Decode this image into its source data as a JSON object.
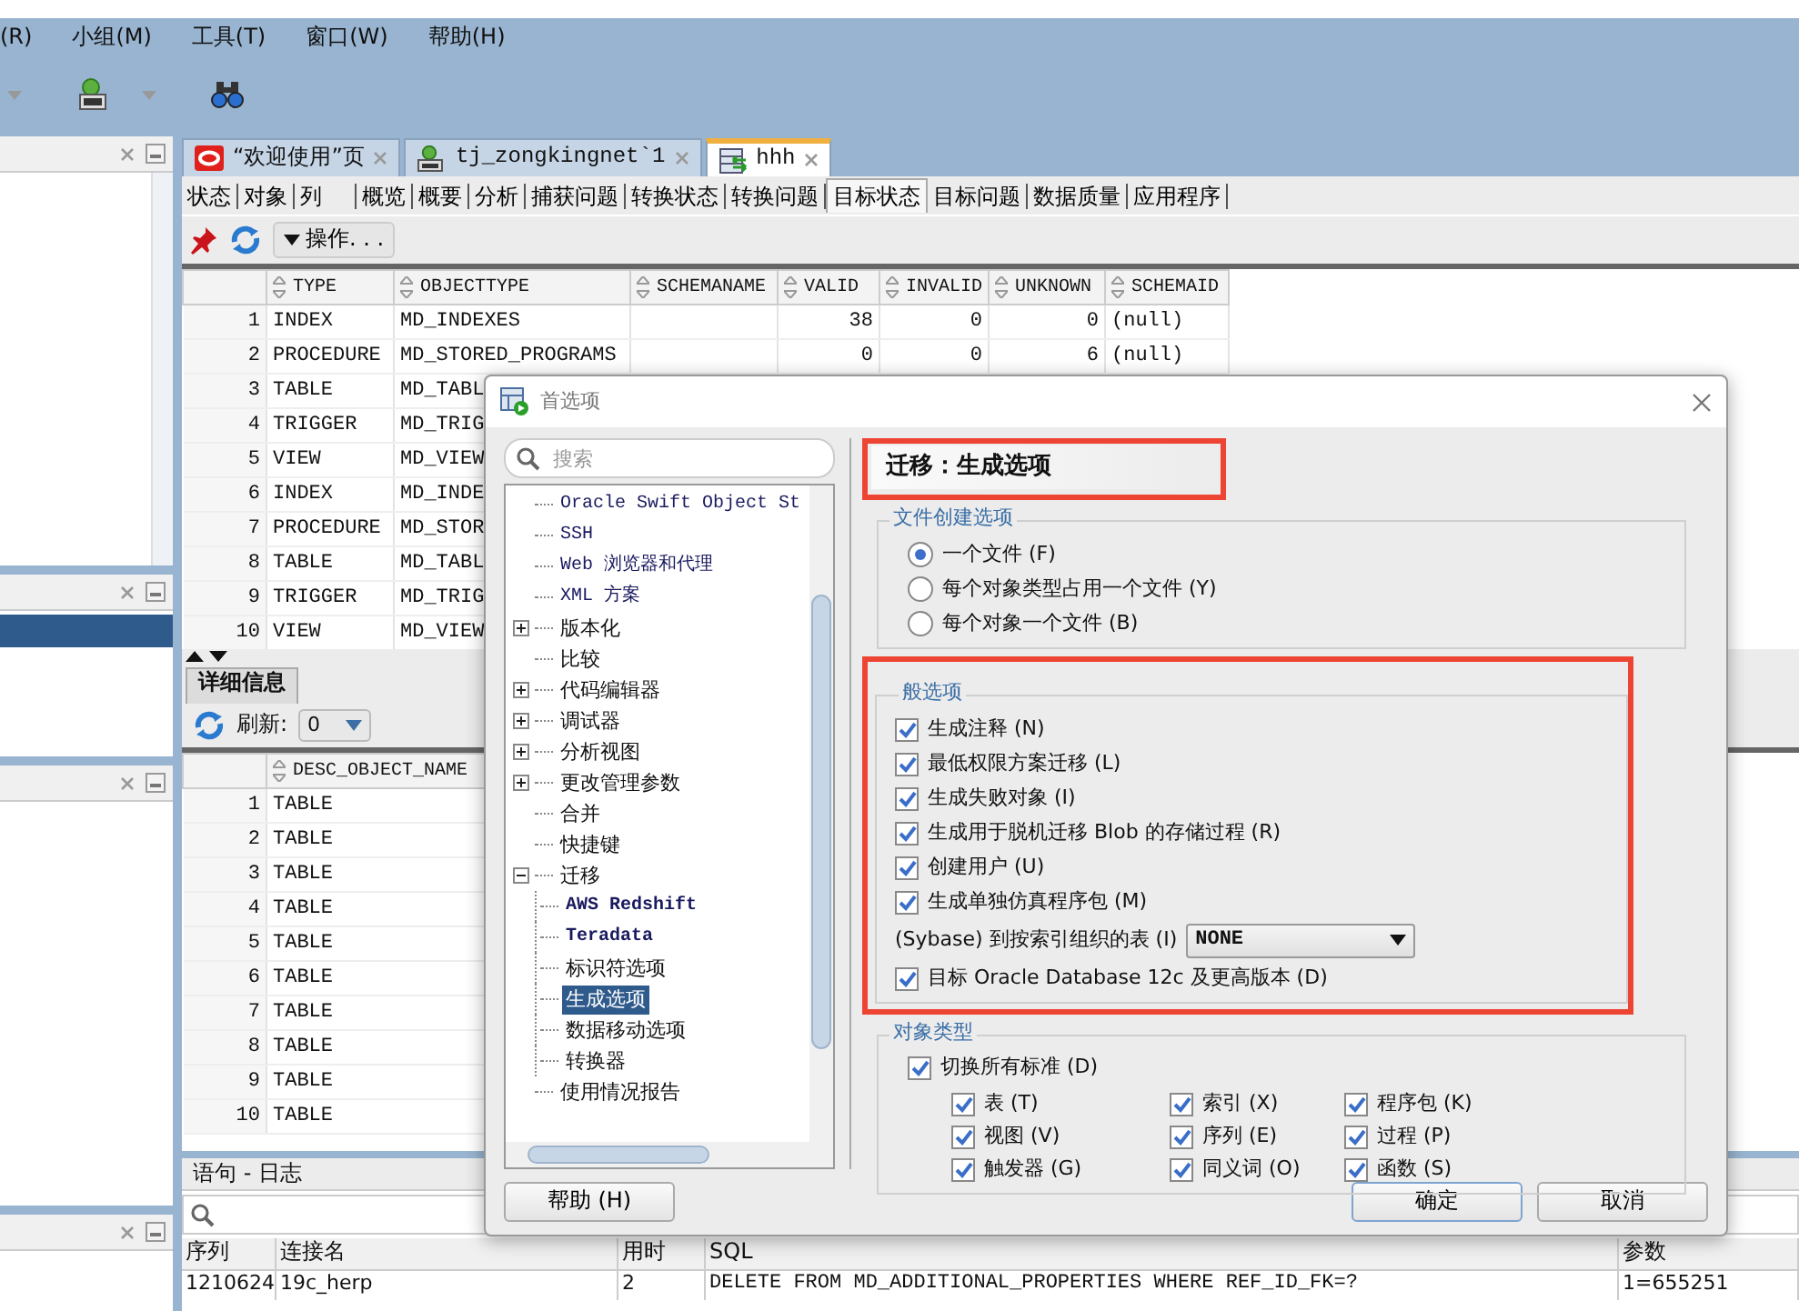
{
  "menu": [
    "(R)",
    "小组(M)",
    "工具(T)",
    "窗口(W)",
    "帮助(H)"
  ],
  "left_panels": [
    {
      "kind": "empty"
    },
    {
      "kind": "list",
      "rows": [
        {
          "selected": true
        }
      ]
    },
    {
      "kind": "empty"
    },
    {
      "kind": "empty"
    }
  ],
  "editor": {
    "tabs": [
      {
        "label": "“欢迎使用”页",
        "kind": "oracle",
        "selected": false
      },
      {
        "label": "tj_zongkingnet`1",
        "kind": "sql",
        "selected": false
      },
      {
        "label": "hhh",
        "kind": "database",
        "selected": true
      }
    ],
    "subtabs": [
      {
        "label": "状态",
        "selected": false
      },
      {
        "label": "对象",
        "selected": false
      },
      {
        "label": "列",
        "selected": false
      },
      {
        "label": "概览",
        "selected": false
      },
      {
        "label": "概要",
        "selected": false
      },
      {
        "label": "分析",
        "selected": false
      },
      {
        "label": "捕获问题",
        "selected": false
      },
      {
        "label": "转换状态",
        "selected": false
      },
      {
        "label": "转换问题",
        "selected": false
      },
      {
        "label": "目标状态",
        "selected": true
      },
      {
        "label": "目标问题",
        "selected": false
      },
      {
        "label": "数据质量",
        "selected": false
      },
      {
        "label": "应用程序",
        "selected": false
      }
    ],
    "action_button": "操作. . .",
    "grid": {
      "columns": [
        "TYPE",
        "OBJECTTYPE",
        "SCHEMANAME",
        "VALID",
        "INVALID",
        "UNKNOWN",
        "SCHEMAID"
      ],
      "rows": [
        {
          "number": "1",
          "cells": [
            "INDEX",
            "MD_INDEXES",
            null,
            "38",
            "0",
            "0",
            "(null)"
          ]
        },
        {
          "number": "2",
          "cells": [
            "PROCEDURE",
            "MD_STORED_PROGRAMS",
            null,
            "0",
            "0",
            "6",
            "(null)"
          ]
        },
        {
          "number": "3",
          "cells": [
            "TABLE",
            "MD_TABL"
          ]
        },
        {
          "number": "4",
          "cells": [
            "TRIGGER",
            "MD_TRIG"
          ]
        },
        {
          "number": "5",
          "cells": [
            "VIEW",
            "MD_VIEW"
          ]
        },
        {
          "number": "6",
          "cells": [
            "INDEX",
            "MD_INDE"
          ]
        },
        {
          "number": "7",
          "cells": [
            "PROCEDURE",
            "MD_STOR"
          ]
        },
        {
          "number": "8",
          "cells": [
            "TABLE",
            "MD_TABL"
          ]
        },
        {
          "number": "9",
          "cells": [
            "TRIGGER",
            "MD_TRIG"
          ]
        },
        {
          "number": "10",
          "cells": [
            "VIEW",
            "MD_VIEW"
          ]
        }
      ]
    },
    "detail": {
      "tab": "详细信息",
      "refresh_label": "刷新:",
      "refresh_value": "0",
      "grid": {
        "columns": [
          "DESC_OBJECT_NAME"
        ],
        "rows": [
          {
            "number": "1",
            "cells": [
              "TABLE"
            ]
          },
          {
            "number": "2",
            "cells": [
              "TABLE"
            ]
          },
          {
            "number": "3",
            "cells": [
              "TABLE"
            ]
          },
          {
            "number": "4",
            "cells": [
              "TABLE"
            ]
          },
          {
            "number": "5",
            "cells": [
              "TABLE"
            ]
          },
          {
            "number": "6",
            "cells": [
              "TABLE"
            ]
          },
          {
            "number": "7",
            "cells": [
              "TABLE"
            ]
          },
          {
            "number": "8",
            "cells": [
              "TABLE"
            ]
          },
          {
            "number": "9",
            "cells": [
              "TABLE"
            ]
          },
          {
            "number": "10",
            "cells": [
              "TABLE"
            ]
          }
        ]
      }
    },
    "log": {
      "title": "语句 - 日志",
      "columns": [
        "序列",
        "连接名",
        "用时",
        "SQL",
        "参数"
      ],
      "rows": [
        {
          "cells": [
            "1210624",
            "19c_herp",
            "2",
            "DELETE FROM MD_ADDITIONAL_PROPERTIES WHERE REF_ID_FK=?",
            "1=655251"
          ]
        }
      ]
    }
  },
  "dialog": {
    "title": "首选项",
    "search": {
      "placeholder": "搜索"
    },
    "tree": [
      {
        "label": "Oracle Swift Object St"
      },
      {
        "label": "SSH"
      },
      {
        "label": "Web 浏览器和代理"
      },
      {
        "label": "XML 方案"
      },
      {
        "label": "版本化",
        "expanded": false
      },
      {
        "label": "比较"
      },
      {
        "label": "代码编辑器",
        "expanded": false
      },
      {
        "label": "调试器",
        "expanded": false
      },
      {
        "label": "分析视图",
        "expanded": false
      },
      {
        "label": "更改管理参数",
        "expanded": false
      },
      {
        "label": "合并"
      },
      {
        "label": "快捷键"
      },
      {
        "label": "迁移",
        "expanded": true,
        "children": [
          {
            "label": "AWS Redshift",
            "selected": false
          },
          {
            "label": "Teradata",
            "selected": false
          },
          {
            "label": "标识符选项",
            "selected": false
          },
          {
            "label": "生成选项",
            "selected": true
          },
          {
            "label": "数据移动选项",
            "selected": false
          },
          {
            "label": "转换器",
            "selected": false
          }
        ]
      },
      {
        "label": "使用情况报告"
      }
    ],
    "heading": "迁移：生成选项",
    "file_group": {
      "title": "文件创建选项",
      "options": [
        {
          "label": "一个文件 (F)",
          "selected": true
        },
        {
          "label": "每个对象类型占用一个文件 (Y)",
          "selected": false
        },
        {
          "label": "每个对象一个文件 (B)",
          "selected": false
        }
      ]
    },
    "general_group": {
      "title": "般选项",
      "items": [
        {
          "kind": "checkbox",
          "label": "生成注释 (N)",
          "checked": true
        },
        {
          "kind": "checkbox",
          "label": "最低权限方案迁移 (L)",
          "checked": true
        },
        {
          "kind": "checkbox",
          "label": "生成失败对象 (I)",
          "checked": true
        },
        {
          "kind": "checkbox",
          "label": "生成用于脱机迁移 Blob 的存储过程 (R)",
          "checked": true
        },
        {
          "kind": "checkbox",
          "label": "创建用户 (U)",
          "checked": true
        },
        {
          "kind": "checkbox",
          "label": "生成单独仿真程序包 (M)",
          "checked": true
        },
        {
          "kind": "select",
          "label": "(Sybase) 到按索引组织的表 (I)",
          "value": "NONE"
        },
        {
          "kind": "checkbox",
          "label": "目标 Oracle Database 12c 及更高版本 (D)",
          "checked": true
        }
      ]
    },
    "object_group": {
      "title": "对象类型",
      "toggle_all": {
        "label": "切换所有标准 (D)",
        "checked": true
      },
      "types": [
        {
          "label": "表 (T)",
          "checked": true
        },
        {
          "label": "索引 (X)",
          "checked": true
        },
        {
          "label": "程序包 (K)",
          "checked": true
        },
        {
          "label": "视图 (V)",
          "checked": true
        },
        {
          "label": "序列 (E)",
          "checked": true
        },
        {
          "label": "过程 (P)",
          "checked": true
        },
        {
          "label": "触发器 (G)",
          "checked": true
        },
        {
          "label": "同义词 (O)",
          "checked": true
        },
        {
          "label": "函数 (S)",
          "checked": true
        }
      ]
    },
    "buttons": {
      "help": "帮助 (H)",
      "ok": "确定",
      "cancel": "取消"
    }
  }
}
